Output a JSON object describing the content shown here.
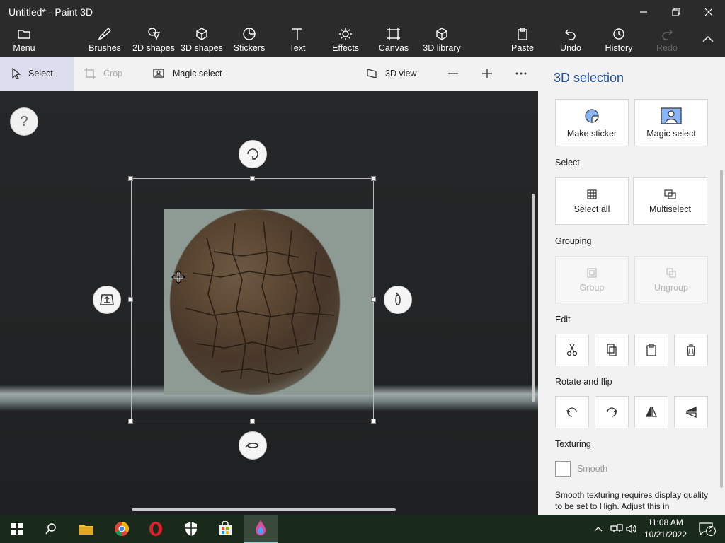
{
  "window": {
    "title": "Untitled* - Paint 3D"
  },
  "ribbon": {
    "menu": "Menu",
    "brushes": "Brushes",
    "shapes2d": "2D shapes",
    "shapes3d": "3D shapes",
    "stickers": "Stickers",
    "text": "Text",
    "effects": "Effects",
    "canvas": "Canvas",
    "library3d": "3D library",
    "paste": "Paste",
    "undo": "Undo",
    "history": "History",
    "redo": "Redo"
  },
  "toolbar": {
    "select": "Select",
    "crop": "Crop",
    "magic_select": "Magic select",
    "view3d": "3D view"
  },
  "canvas": {
    "help": "?"
  },
  "panel": {
    "title": "3D selection",
    "make_sticker": "Make sticker",
    "magic_select": "Magic select",
    "select_heading": "Select",
    "select_all": "Select all",
    "multiselect": "Multiselect",
    "grouping_heading": "Grouping",
    "group": "Group",
    "ungroup": "Ungroup",
    "edit_heading": "Edit",
    "rotate_heading": "Rotate and flip",
    "texturing_heading": "Texturing",
    "smooth": "Smooth",
    "smooth_note": "Smooth texturing requires display quality to be set to High. Adjust this in",
    "smooth_checked": false
  },
  "taskbar": {
    "time": "11:08 AM",
    "date": "10/21/2022",
    "notifications": "2"
  },
  "colors": {
    "accent": "#1f4fa0",
    "titlebar": "#2b2b2b",
    "panel": "#f2f2f2"
  }
}
